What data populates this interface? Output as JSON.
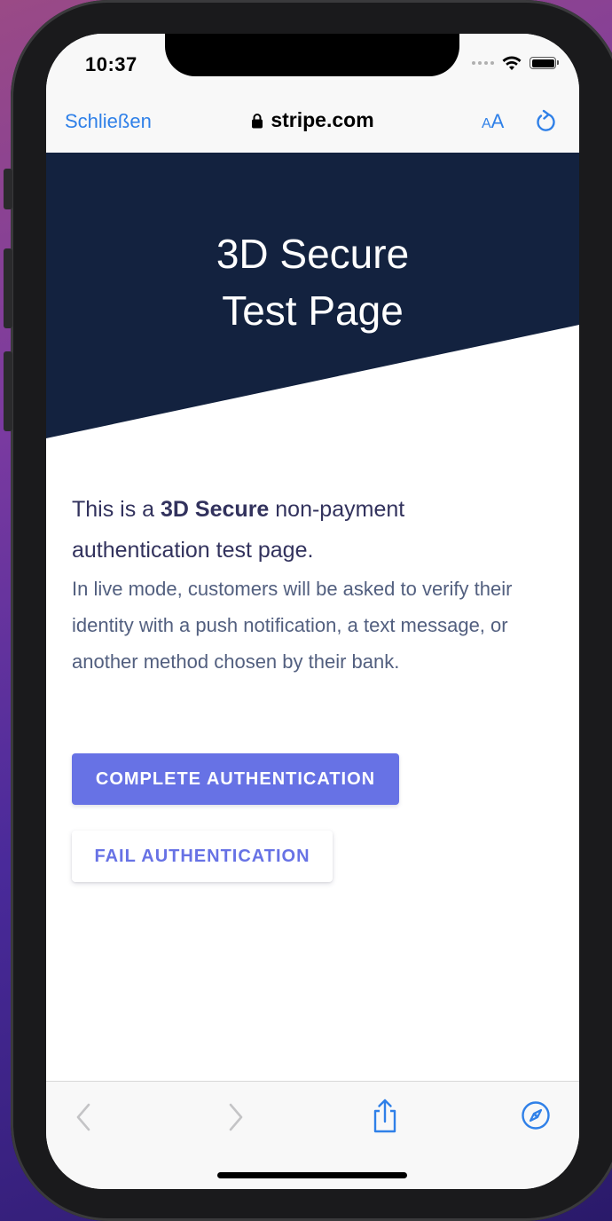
{
  "status_bar": {
    "time": "10:37"
  },
  "browser": {
    "close_label": "Schließen",
    "url": "stripe.com",
    "text_size_label_small": "A",
    "text_size_label_large": "A"
  },
  "hero": {
    "title_line1": "3D Secure",
    "title_line2": "Test Page"
  },
  "content": {
    "lead_prefix": "This is a ",
    "lead_bold": "3D Secure",
    "lead_suffix": " non-payment authentication test page.",
    "description": "In live mode, customers will be asked to verify their identity with a push notification, a text message, or another method chosen by their bank."
  },
  "buttons": {
    "complete_label": "COMPLETE AUTHENTICATION",
    "fail_label": "FAIL AUTHENTICATION"
  },
  "colors": {
    "hero_background": "#13223f",
    "accent": "#6772e5",
    "link_blue": "#2f80e8",
    "heading_text": "#32325d",
    "body_text": "#525f7f"
  },
  "icons": {
    "toolbar": [
      "back-icon",
      "forward-icon",
      "share-icon",
      "compass-icon"
    ]
  }
}
